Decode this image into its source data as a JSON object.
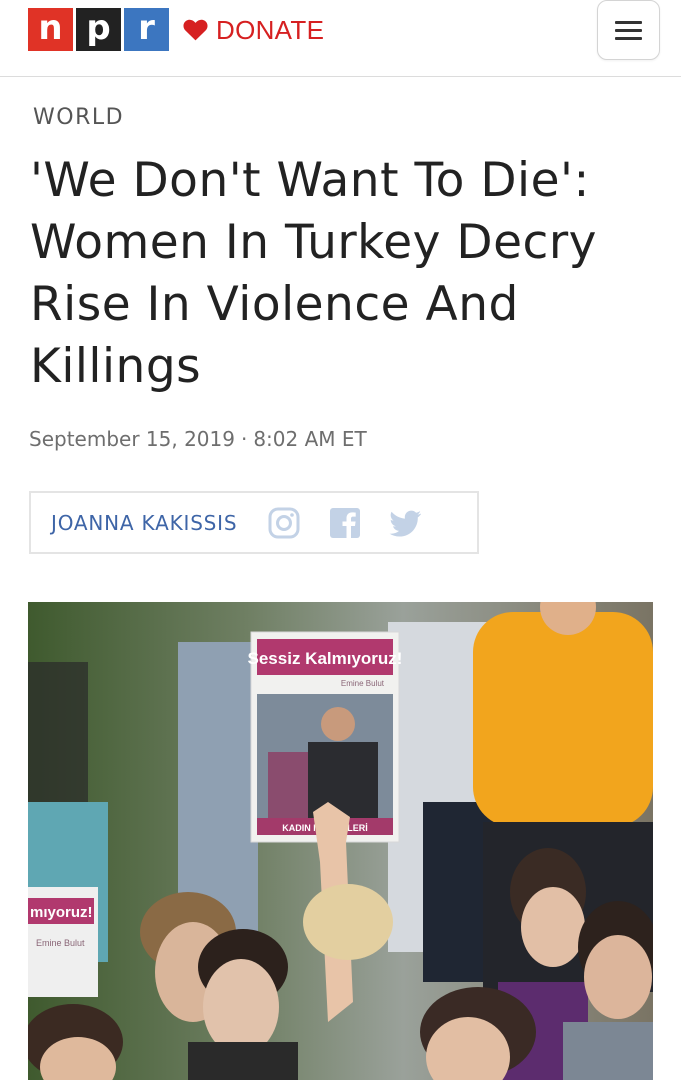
{
  "header": {
    "logo": {
      "letters": [
        "n",
        "p",
        "r"
      ],
      "colors": [
        "#e03326",
        "#222222",
        "#3c76c0"
      ]
    },
    "donate": {
      "icon": "heart-icon",
      "label": "DONATE",
      "color": "#d62021"
    },
    "menu": {
      "icon": "hamburger-menu-icon"
    }
  },
  "article": {
    "section": "WORLD",
    "headline": "'We Don't Want To Die': Women In Turkey Decry Rise In Violence And Killings",
    "date": "September 15, 2019",
    "separator": "·",
    "time": "8:02 AM ET",
    "author": "JOANNA KAKISSIS",
    "social_icons": [
      "instagram-icon",
      "facebook-icon",
      "twitter-icon"
    ]
  },
  "photo": {
    "sign_main_heading": "Sessiz Kalmıyoruz!",
    "sign_main_name": "Emine Bulut",
    "sign_main_footer": "KADIN MECLİSLERİ",
    "sign_left_heading": "mıyoruz!",
    "sign_left_name": "Emine Bulut"
  }
}
